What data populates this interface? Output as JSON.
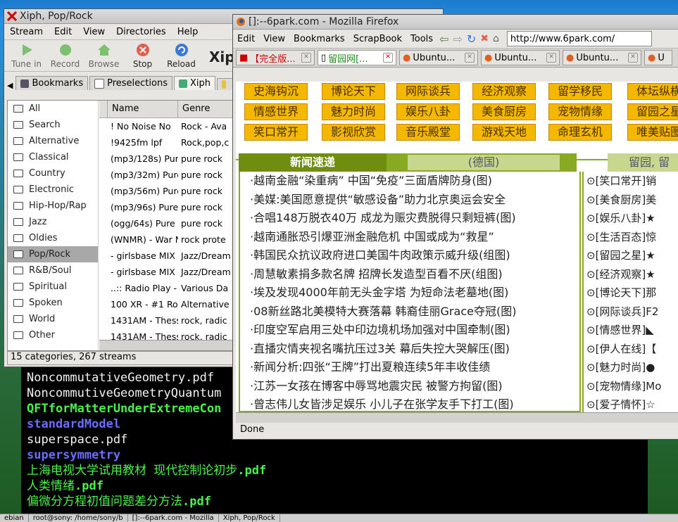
{
  "terminal": {
    "lines": [
      {
        "text": "NoncommutativeGeometry.pdf",
        "style": "white"
      },
      {
        "text": "NoncommutiveGeometryQuantum",
        "style": "white"
      },
      {
        "text": "QFTforMatterUnderExtremeCon",
        "style": "green"
      },
      {
        "text": "standardModel",
        "style": "blue"
      },
      {
        "text": "superspace.pdf",
        "style": "white"
      },
      {
        "text": "supersymmetry",
        "style": "blue"
      }
    ],
    "cn_line1": "上海电视大学试用教材  现代控制论初步",
    "cn_line2": "人类情绪",
    "cn_line3": "偏微分方程初值问题差分方法",
    "pdf_ext": ".pdf"
  },
  "xiph": {
    "title": "Xiph, Pop/Rock",
    "menu": [
      "Stream",
      "Edit",
      "View",
      "Directories",
      "Help"
    ],
    "toolbar": [
      "Tune in",
      "Record",
      "Browse",
      "Stop",
      "Reload"
    ],
    "title_fragment": "Xip",
    "tabs": [
      "Bookmarks",
      "Preselections",
      "Xiph"
    ],
    "categories": [
      "All",
      "Search",
      "Alternative",
      "Classical",
      "Country",
      "Electronic",
      "Hip-Hop/Rap",
      "Jazz",
      "Oldies",
      "Pop/Rock",
      "R&B/Soul",
      "Spiritual",
      "Spoken",
      "World",
      "Other"
    ],
    "selected_category": "Pop/Rock",
    "columns": [
      "Name",
      "Genre"
    ],
    "streams": [
      [
        "! No Noise No",
        "Rock - Ava"
      ],
      [
        "!9425fm lpf",
        "Rock,pop,c"
      ],
      [
        "(mp3/128s) Pur",
        "pure rock"
      ],
      [
        "(mp3/32m) Pure",
        "pure rock"
      ],
      [
        "(mp3/56m) Pure",
        "pure rock"
      ],
      [
        "(mp3/96s) Pure",
        "pure rock"
      ],
      [
        "(ogg/64s) Pure",
        "pure rock"
      ],
      [
        "(WNMR) - War N",
        "rock prote"
      ],
      [
        "- girlsbase MIX",
        "Jazz/Dream"
      ],
      [
        "- girlsbase MIX",
        "Jazz/Dream"
      ],
      [
        "..:: Radio Play -",
        "Various Da"
      ],
      [
        "100 XR - #1 Ro",
        "Alternative"
      ],
      [
        "1431AM - Thess",
        "rock, radic"
      ],
      [
        "1431AM - Thess",
        "rock, radic"
      ]
    ],
    "status": "15 categories, 267 streams"
  },
  "firefox": {
    "title": "[]:--6park.com - Mozilla Firefox",
    "menu": [
      "Edit",
      "View",
      "Bookmarks",
      "ScrapBook",
      "Tools"
    ],
    "url": "http://www.6park.com/",
    "tabs": [
      "【完全版...",
      "留园网[...",
      "Ubuntu...",
      "Ubuntu...",
      "Ubuntu...",
      "U"
    ],
    "nav": [
      [
        "史海钩沉",
        "博论天下",
        "网际谈兵",
        "经济观察",
        "留学移民",
        "体坛纵横"
      ],
      [
        "情感世界",
        "魅力时尚",
        "娱乐八卦",
        "美食厨房",
        "宠物情缘",
        "留园之星"
      ],
      [
        "笑口常开",
        "影视欣赏",
        "音乐殿堂",
        "游戏天地",
        "命理玄机",
        "唯美贴图"
      ]
    ],
    "news_header": "新闻速递",
    "news_sub": "(德国)",
    "side_header": "留园, 留",
    "news": [
      "·越南金融“染重病” 中国“免疫”三面盾牌防身(图)",
      "·美媒:美国愿意提供“敏感设备”助力北京奥运会安全",
      "·合唱148万脱衣40万 成龙为赈灾费脱得只剩短裤(图)",
      "·越南通胀恐引爆亚洲金融危机 中国或成为“救星”",
      "·韩国民众抗议政府进口美国牛肉政策示威升级(组图)",
      "·周慧敏素捐多款名牌 招牌长发造型百看不厌(组图)",
      "·埃及发现4000年前无头金字塔 为短命法老墓地(图)",
      "·08新丝路北美模特大赛落幕 韩裔佳丽Grace夺冠(图)",
      "·印度空军启用三处中印边境机场加强对中国牵制(图)",
      "·直播灾情夹视名嘴抗压过3关 幕后失控大哭解压(图)",
      "·新闻分析:四张“王牌”打出夏粮连续5年丰收佳绩",
      "·江苏一女孩在博客中辱骂地震灾民 被警方拘留(图)",
      "·曾志伟儿女皆涉足娱乐 小儿子在张学友手下打工(图)"
    ],
    "side": [
      "⊙[笑口常开]销",
      "⊙[美食厨房]美",
      "⊙[娱乐八卦]★",
      "⊙[生活百态]惊",
      "⊙[留园之星]★",
      "⊙[经济观察]★",
      "⊙[博论天下]那",
      "⊙[网际谈兵]F2",
      "⊙[情感世界]◣",
      "⊙[伊人在线]【",
      "⊙[魅力时尚]●",
      "⊙[宠物情缘]Mo",
      "⊙[爱子情怀]☆"
    ],
    "status": "Done"
  },
  "taskbar": [
    "ebian",
    "root@sony: /home/sony/b",
    "[]:--6park.com - Mozilla",
    "Xiph, Pop/Rock"
  ]
}
